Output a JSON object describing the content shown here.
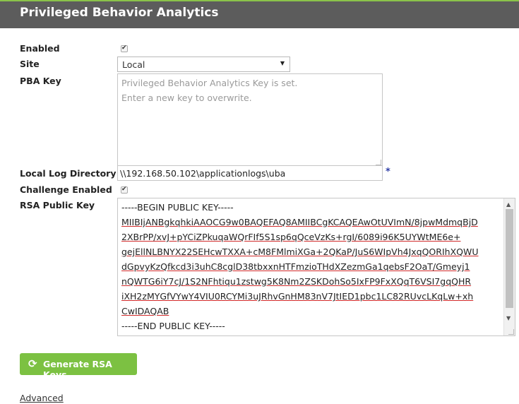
{
  "header": {
    "title": "Privileged Behavior Analytics"
  },
  "form": {
    "enabled": {
      "label": "Enabled",
      "checked": true
    },
    "site": {
      "label": "Site",
      "value": "Local"
    },
    "pba_key": {
      "label": "PBA Key",
      "placeholder_line1": "Privileged Behavior Analytics Key is set.",
      "placeholder_line2": "Enter a new key to overwrite."
    },
    "local_log_directory": {
      "label": "Local Log Directory",
      "value": "\\\\192.168.50.102\\applicationlogs\\uba",
      "required_marker": "*"
    },
    "challenge_enabled": {
      "label": "Challenge Enabled",
      "checked": true
    },
    "rsa_public_key": {
      "label": "RSA Public Key",
      "lines": [
        "-----BEGIN PUBLIC KEY-----",
        "MIIBIjANBgkqhkiAAOCG9w0BAQEFAQ8AMIIBCgKCAQEAwOtUVImN/8jpwMdmqBjD",
        "2XBrPP/xvJ+pYCiZPkuqaWQrFIf5S1sp6qQceVzKs+rgI/6089i96K5UYWtME6e+",
        "gejEllNLBNYX22SEHcwTXXA+cM8FMlmiXGa+2QKaP/JuS6WIpVh4JxqQORIhXQWU",
        "dGpvyKzQfkcd3i3uhC8cglD38tbxxnHTFmzioTHdXZezmGa1qebsF2OaT/Gmeyj1",
        "nQWTG6iY7cJ/1S2NFhtiqu1zstwg5K8Nm2ZSKDohSo5IxFP9FxXQqT6VSI7gqQHR",
        "iXH2zMYGfVYwY4VIU0RCYMi3uJRhvGnHM83nV7JtIED1pbc1LC82RUvcLKqLw+xh",
        "CwIDAQAB",
        "-----END PUBLIC KEY-----"
      ]
    }
  },
  "actions": {
    "generate_label": "Generate RSA Keys",
    "generate_icon": "refresh-icon"
  },
  "links": {
    "advanced": "Advanced"
  },
  "colors": {
    "header_bg": "#5c5c5c",
    "accent_green": "#7cc142",
    "required_star": "#2f3fa8"
  }
}
